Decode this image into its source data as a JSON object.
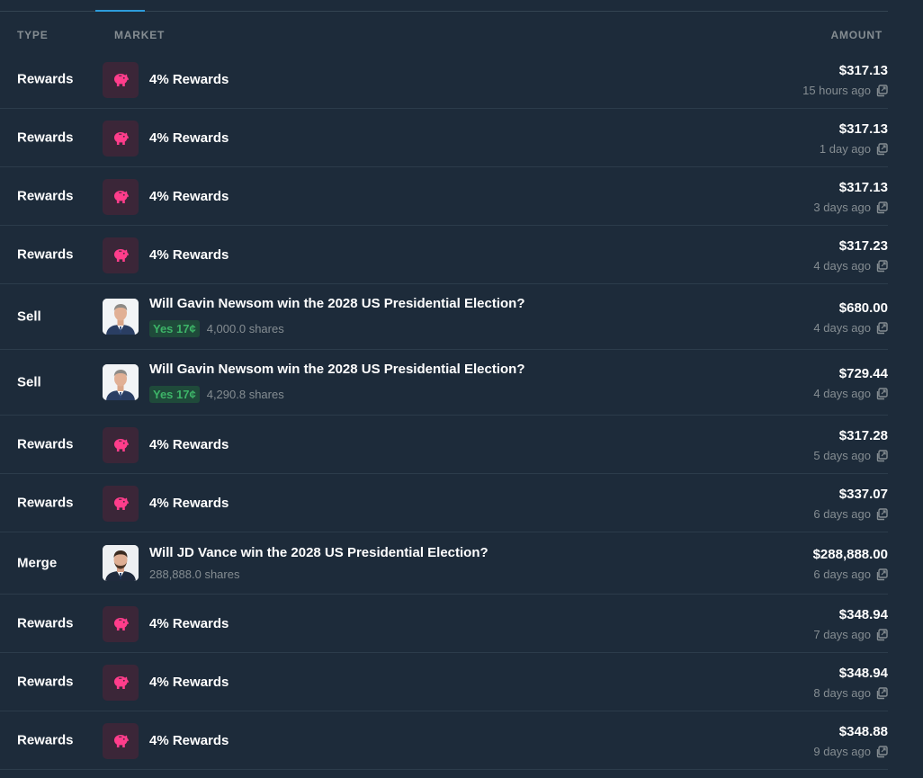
{
  "header": {
    "type": "TYPE",
    "market": "MARKET",
    "amount": "AMOUNT"
  },
  "colors": {
    "background": "#1d2b3a",
    "muted_text": "#858d92",
    "reward_icon_bg": "#3b2638",
    "reward_icon": "#ff3d8b",
    "outcome_yes_bg": "#1f4a3a",
    "outcome_yes_text": "#3db468",
    "tab_accent": "#2d9cdb"
  },
  "rows": [
    {
      "type": "Rewards",
      "icon": "piggy-bank-icon",
      "market": "4% Rewards",
      "amount": "$317.13",
      "time": "15 hours ago"
    },
    {
      "type": "Rewards",
      "icon": "piggy-bank-icon",
      "market": "4% Rewards",
      "amount": "$317.13",
      "time": "1 day ago"
    },
    {
      "type": "Rewards",
      "icon": "piggy-bank-icon",
      "market": "4% Rewards",
      "amount": "$317.13",
      "time": "3 days ago"
    },
    {
      "type": "Rewards",
      "icon": "piggy-bank-icon",
      "market": "4% Rewards",
      "amount": "$317.23",
      "time": "4 days ago"
    },
    {
      "type": "Sell",
      "icon": "gavin-newsom-avatar",
      "market": "Will Gavin Newsom win the 2028 US Presidential Election?",
      "outcome": "Yes 17¢",
      "shares": "4,000.0 shares",
      "amount": "$680.00",
      "time": "4 days ago"
    },
    {
      "type": "Sell",
      "icon": "gavin-newsom-avatar",
      "market": "Will Gavin Newsom win the 2028 US Presidential Election?",
      "outcome": "Yes 17¢",
      "shares": "4,290.8 shares",
      "amount": "$729.44",
      "time": "4 days ago"
    },
    {
      "type": "Rewards",
      "icon": "piggy-bank-icon",
      "market": "4% Rewards",
      "amount": "$317.28",
      "time": "5 days ago"
    },
    {
      "type": "Rewards",
      "icon": "piggy-bank-icon",
      "market": "4% Rewards",
      "amount": "$337.07",
      "time": "6 days ago"
    },
    {
      "type": "Merge",
      "icon": "jd-vance-avatar",
      "market": "Will JD Vance win the 2028 US Presidential Election?",
      "shares": "288,888.0 shares",
      "amount": "$288,888.00",
      "time": "6 days ago"
    },
    {
      "type": "Rewards",
      "icon": "piggy-bank-icon",
      "market": "4% Rewards",
      "amount": "$348.94",
      "time": "7 days ago"
    },
    {
      "type": "Rewards",
      "icon": "piggy-bank-icon",
      "market": "4% Rewards",
      "amount": "$348.94",
      "time": "8 days ago"
    },
    {
      "type": "Rewards",
      "icon": "piggy-bank-icon",
      "market": "4% Rewards",
      "amount": "$348.88",
      "time": "9 days ago"
    }
  ]
}
